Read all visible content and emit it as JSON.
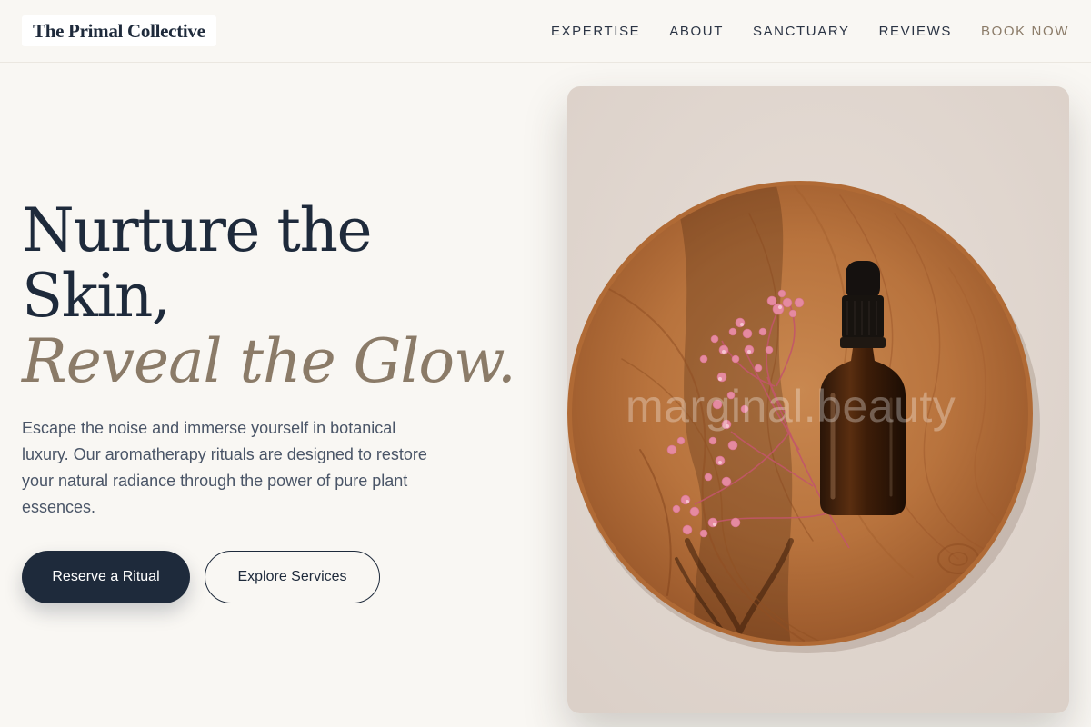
{
  "header": {
    "brand": "The Primal Collective",
    "nav": [
      {
        "label": "EXPERTISE"
      },
      {
        "label": "ABOUT"
      },
      {
        "label": "SANCTUARY"
      },
      {
        "label": "REVIEWS"
      },
      {
        "label": "BOOK NOW"
      }
    ]
  },
  "hero": {
    "title_line1": "Nurture the",
    "title_line2": "Skin,",
    "title_accent": "Reveal the Glow.",
    "description": "Escape the noise and immerse yourself in botanical luxury. Our aromatherapy rituals are designed to restore your natural radiance through the power of pure plant essences.",
    "primary_button": "Reserve a Ritual",
    "secondary_button": "Explore Services"
  },
  "image": {
    "watermark": "marginal.beauty"
  },
  "colors": {
    "background": "#f9f7f3",
    "navy": "#1e2a3b",
    "accent_taupe": "#8b7b68",
    "body_text": "#4a5567"
  }
}
